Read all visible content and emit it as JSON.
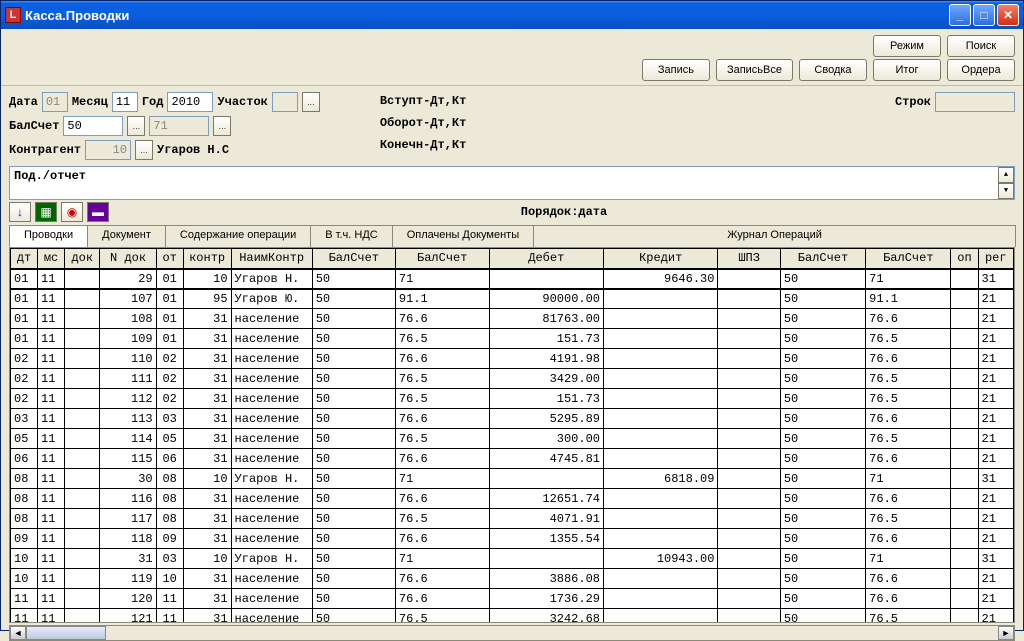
{
  "title": "Касса.Проводки",
  "buttons_top": {
    "mode": "Режим",
    "search": "Поиск"
  },
  "buttons2": {
    "record": "Запись",
    "recordall": "ЗаписьВсе",
    "summary": "Сводка",
    "total": "Итог",
    "orders": "Ордера"
  },
  "filters": {
    "date_lbl": "Дата",
    "date_val": "01",
    "month_lbl": "Месяц",
    "month_val": "11",
    "year_lbl": "Год",
    "year_val": "2010",
    "uchastok_lbl": "Участок",
    "uchastok_val": "",
    "balschet_lbl": "БалСчет",
    "balschet_val": "50",
    "balschet2": "71",
    "kontr_lbl": "Контрагент",
    "kontr_val": "10",
    "kontr_name": "Угаров Н.С",
    "vstup": "Вступт-Дт,Кт",
    "oborot": "Оборот-Дт,Кт",
    "konech": "Конечн-Дт,Кт",
    "strok_lbl": "Строк",
    "strok_val": ""
  },
  "desc": "Под./отчет",
  "order": "Порядок:дата",
  "tabs": {
    "provodki": "Проводки",
    "doc": "Документ",
    "soder": "Содержание операции",
    "nds": "В т.ч. НДС",
    "opl": "Оплачены Документы",
    "journal": "Журнал Операций"
  },
  "cols": [
    "дт",
    "мс",
    "док",
    "N док",
    "от",
    "контр",
    "НаимКонтр",
    "БалСчет",
    "БалСчет",
    "Дебет",
    "Кредит",
    "ШПЗ",
    "БалСчет",
    "БалСчет",
    "оп",
    "рег"
  ],
  "rows": [
    {
      "dt": "01",
      "ms": "11",
      "dok": "",
      "ndok": "29",
      "ot": "01",
      "kontr": "10",
      "naim": "Угаров Н.",
      "bs1": "50",
      "bs2": "71",
      "debet": "",
      "kredit": "9646.30",
      "shpz": "",
      "bs3": "50",
      "bs4": "71",
      "op": "",
      "reg": "31"
    },
    {
      "dt": "01",
      "ms": "11",
      "dok": "",
      "ndok": "107",
      "ot": "01",
      "kontr": "95",
      "naim": "Угаров Ю.",
      "bs1": "50",
      "bs2": "91.1",
      "debet": "90000.00",
      "kredit": "",
      "shpz": "",
      "bs3": "50",
      "bs4": "91.1",
      "op": "",
      "reg": "21"
    },
    {
      "dt": "01",
      "ms": "11",
      "dok": "",
      "ndok": "108",
      "ot": "01",
      "kontr": "31",
      "naim": "население",
      "bs1": "50",
      "bs2": "76.6",
      "debet": "81763.00",
      "kredit": "",
      "shpz": "",
      "bs3": "50",
      "bs4": "76.6",
      "op": "",
      "reg": "21"
    },
    {
      "dt": "01",
      "ms": "11",
      "dok": "",
      "ndok": "109",
      "ot": "01",
      "kontr": "31",
      "naim": "население",
      "bs1": "50",
      "bs2": "76.5",
      "debet": "151.73",
      "kredit": "",
      "shpz": "",
      "bs3": "50",
      "bs4": "76.5",
      "op": "",
      "reg": "21"
    },
    {
      "dt": "02",
      "ms": "11",
      "dok": "",
      "ndok": "110",
      "ot": "02",
      "kontr": "31",
      "naim": "население",
      "bs1": "50",
      "bs2": "76.6",
      "debet": "4191.98",
      "kredit": "",
      "shpz": "",
      "bs3": "50",
      "bs4": "76.6",
      "op": "",
      "reg": "21"
    },
    {
      "dt": "02",
      "ms": "11",
      "dok": "",
      "ndok": "111",
      "ot": "02",
      "kontr": "31",
      "naim": "население",
      "bs1": "50",
      "bs2": "76.5",
      "debet": "3429.00",
      "kredit": "",
      "shpz": "",
      "bs3": "50",
      "bs4": "76.5",
      "op": "",
      "reg": "21"
    },
    {
      "dt": "02",
      "ms": "11",
      "dok": "",
      "ndok": "112",
      "ot": "02",
      "kontr": "31",
      "naim": "население",
      "bs1": "50",
      "bs2": "76.5",
      "debet": "151.73",
      "kredit": "",
      "shpz": "",
      "bs3": "50",
      "bs4": "76.5",
      "op": "",
      "reg": "21"
    },
    {
      "dt": "03",
      "ms": "11",
      "dok": "",
      "ndok": "113",
      "ot": "03",
      "kontr": "31",
      "naim": "население",
      "bs1": "50",
      "bs2": "76.6",
      "debet": "5295.89",
      "kredit": "",
      "shpz": "",
      "bs3": "50",
      "bs4": "76.6",
      "op": "",
      "reg": "21"
    },
    {
      "dt": "05",
      "ms": "11",
      "dok": "",
      "ndok": "114",
      "ot": "05",
      "kontr": "31",
      "naim": "население",
      "bs1": "50",
      "bs2": "76.5",
      "debet": "300.00",
      "kredit": "",
      "shpz": "",
      "bs3": "50",
      "bs4": "76.5",
      "op": "",
      "reg": "21"
    },
    {
      "dt": "06",
      "ms": "11",
      "dok": "",
      "ndok": "115",
      "ot": "06",
      "kontr": "31",
      "naim": "население",
      "bs1": "50",
      "bs2": "76.6",
      "debet": "4745.81",
      "kredit": "",
      "shpz": "",
      "bs3": "50",
      "bs4": "76.6",
      "op": "",
      "reg": "21"
    },
    {
      "dt": "08",
      "ms": "11",
      "dok": "",
      "ndok": "30",
      "ot": "08",
      "kontr": "10",
      "naim": "Угаров Н.",
      "bs1": "50",
      "bs2": "71",
      "debet": "",
      "kredit": "6818.09",
      "shpz": "",
      "bs3": "50",
      "bs4": "71",
      "op": "",
      "reg": "31"
    },
    {
      "dt": "08",
      "ms": "11",
      "dok": "",
      "ndok": "116",
      "ot": "08",
      "kontr": "31",
      "naim": "население",
      "bs1": "50",
      "bs2": "76.6",
      "debet": "12651.74",
      "kredit": "",
      "shpz": "",
      "bs3": "50",
      "bs4": "76.6",
      "op": "",
      "reg": "21"
    },
    {
      "dt": "08",
      "ms": "11",
      "dok": "",
      "ndok": "117",
      "ot": "08",
      "kontr": "31",
      "naim": "население",
      "bs1": "50",
      "bs2": "76.5",
      "debet": "4071.91",
      "kredit": "",
      "shpz": "",
      "bs3": "50",
      "bs4": "76.5",
      "op": "",
      "reg": "21"
    },
    {
      "dt": "09",
      "ms": "11",
      "dok": "",
      "ndok": "118",
      "ot": "09",
      "kontr": "31",
      "naim": "население",
      "bs1": "50",
      "bs2": "76.6",
      "debet": "1355.54",
      "kredit": "",
      "shpz": "",
      "bs3": "50",
      "bs4": "76.6",
      "op": "",
      "reg": "21"
    },
    {
      "dt": "10",
      "ms": "11",
      "dok": "",
      "ndok": "31",
      "ot": "03",
      "kontr": "10",
      "naim": "Угаров Н.",
      "bs1": "50",
      "bs2": "71",
      "debet": "",
      "kredit": "10943.00",
      "shpz": "",
      "bs3": "50",
      "bs4": "71",
      "op": "",
      "reg": "31"
    },
    {
      "dt": "10",
      "ms": "11",
      "dok": "",
      "ndok": "119",
      "ot": "10",
      "kontr": "31",
      "naim": "население",
      "bs1": "50",
      "bs2": "76.6",
      "debet": "3886.08",
      "kredit": "",
      "shpz": "",
      "bs3": "50",
      "bs4": "76.6",
      "op": "",
      "reg": "21"
    },
    {
      "dt": "11",
      "ms": "11",
      "dok": "",
      "ndok": "120",
      "ot": "11",
      "kontr": "31",
      "naim": "население",
      "bs1": "50",
      "bs2": "76.6",
      "debet": "1736.29",
      "kredit": "",
      "shpz": "",
      "bs3": "50",
      "bs4": "76.6",
      "op": "",
      "reg": "21"
    },
    {
      "dt": "11",
      "ms": "11",
      "dok": "",
      "ndok": "121",
      "ot": "11",
      "kontr": "31",
      "naim": "население",
      "bs1": "50",
      "bs2": "76.5",
      "debet": "3242.68",
      "kredit": "",
      "shpz": "",
      "bs3": "50",
      "bs4": "76.5",
      "op": "",
      "reg": "21"
    }
  ]
}
